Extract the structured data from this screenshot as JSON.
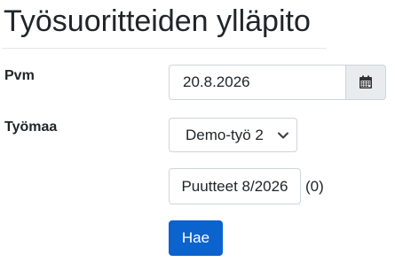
{
  "page": {
    "title": "Työsuoritteiden ylläpito"
  },
  "form": {
    "date_label": "Pvm",
    "date_value": "20.8.2026",
    "date_picker_icon": "calendar-icon",
    "site_label": "Työmaa",
    "site_selected": "Demo-työ 2",
    "site_dropdown_icon": "chevron-down-icon",
    "missing_button_label": "Puutteet 8/2026",
    "missing_count": "(0)",
    "search_button_label": "Hae"
  },
  "colors": {
    "primary_button": "#0b63ce",
    "input_border": "#ced4da",
    "addon_background": "#e9ecef",
    "text": "#212529"
  }
}
